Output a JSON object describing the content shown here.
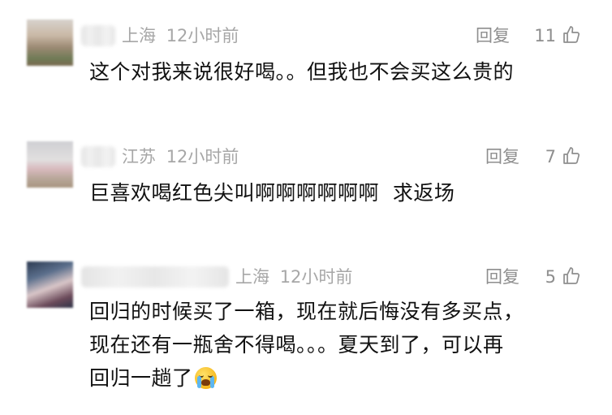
{
  "comments": [
    {
      "location": "上海",
      "time": "12小时前",
      "reply_label": "回复",
      "likes": "11",
      "lines": [
        "这个对我来说很好喝。。但我也不会买这么贵的"
      ]
    },
    {
      "location": "江苏",
      "time": "12小时前",
      "reply_label": "回复",
      "likes": "7",
      "lines": [
        "巨喜欢喝红色尖叫啊啊啊啊啊啊  求返场"
      ]
    },
    {
      "location": "上海",
      "time": "12小时前",
      "reply_label": "回复",
      "likes": "5",
      "lines": [
        "回归的时候买了一箱，现在就后悔没有多买点，",
        "现在还有一瓶舍不得喝。。。夏天到了，可以再",
        "回归一趟了"
      ],
      "trailing_emoji": "crying-face-icon"
    }
  ],
  "colors": {
    "meta": "#a7a7a7",
    "action": "#8e8e8e",
    "text": "#111111"
  }
}
